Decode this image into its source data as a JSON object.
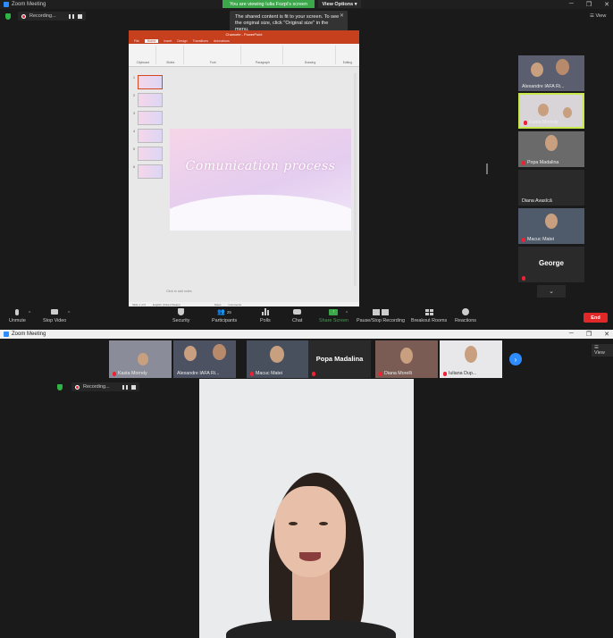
{
  "window1": {
    "title": "Zoom Meeting",
    "banner": "You are viewing Iulia Fozpi's screen",
    "view_options": "View Options",
    "view_label": "View",
    "recording_label": "Recording...",
    "tooltip": "The shared content is fit to your screen. To see the original size, click \"Original size\" in the menu.",
    "tooltip_close": "✕"
  },
  "ppt": {
    "title": "Chancele - PowerPoint",
    "tabs": [
      "File",
      "Home",
      "Insert",
      "Design",
      "Transitions",
      "Animations"
    ],
    "ribbon_groups": [
      "Clipboard",
      "Slides",
      "Font",
      "Paragraph",
      "Drawing",
      "Editing"
    ],
    "slide_numbers": [
      "1",
      "2",
      "3",
      "4",
      "5",
      "6"
    ],
    "slide_title": "Comunication process",
    "notes_placeholder": "Click to add notes",
    "status_slide": "Slide 1 of 6",
    "status_lang": "English (United States)",
    "status_notes": "Notes",
    "status_comments": "Comments"
  },
  "sidebar_participants": [
    {
      "name": "Alexandre IAFA Ri...",
      "muted": false
    },
    {
      "name": "Kasta Morrely",
      "muted": true
    },
    {
      "name": "Popa Madalina",
      "muted": true
    },
    {
      "name": "Diana Avasîcă",
      "muted": false
    },
    {
      "name": "Macuc Matei",
      "muted": true
    },
    {
      "name": "George",
      "muted": true
    }
  ],
  "toolbar": {
    "unmute": "Unmute",
    "stop_video": "Stop Video",
    "security": "Security",
    "participants": "Participants",
    "participants_count": "25",
    "polls": "Polls",
    "chat": "Chat",
    "share_screen": "Share Screen",
    "recording": "Pause/Stop Recording",
    "breakout": "Breakout Rooms",
    "reactions": "Reactions",
    "end": "End"
  },
  "window2": {
    "title": "Zoom Meeting",
    "view_label": "View",
    "recording_label": "Recording...",
    "strip": [
      {
        "name": "Kasta Morrely"
      },
      {
        "name": "Alexandre IAFA Ri..."
      },
      {
        "name": "Macuc Matei"
      },
      {
        "name": "Popa Madalina"
      },
      {
        "name": "Diana Morelli"
      },
      {
        "name": "Iuliana Dup..."
      }
    ]
  },
  "colors": {
    "green": "#3ba64a",
    "red": "#e02828",
    "ppt_orange": "#c7401d",
    "zoom_blue": "#2d8cff"
  }
}
